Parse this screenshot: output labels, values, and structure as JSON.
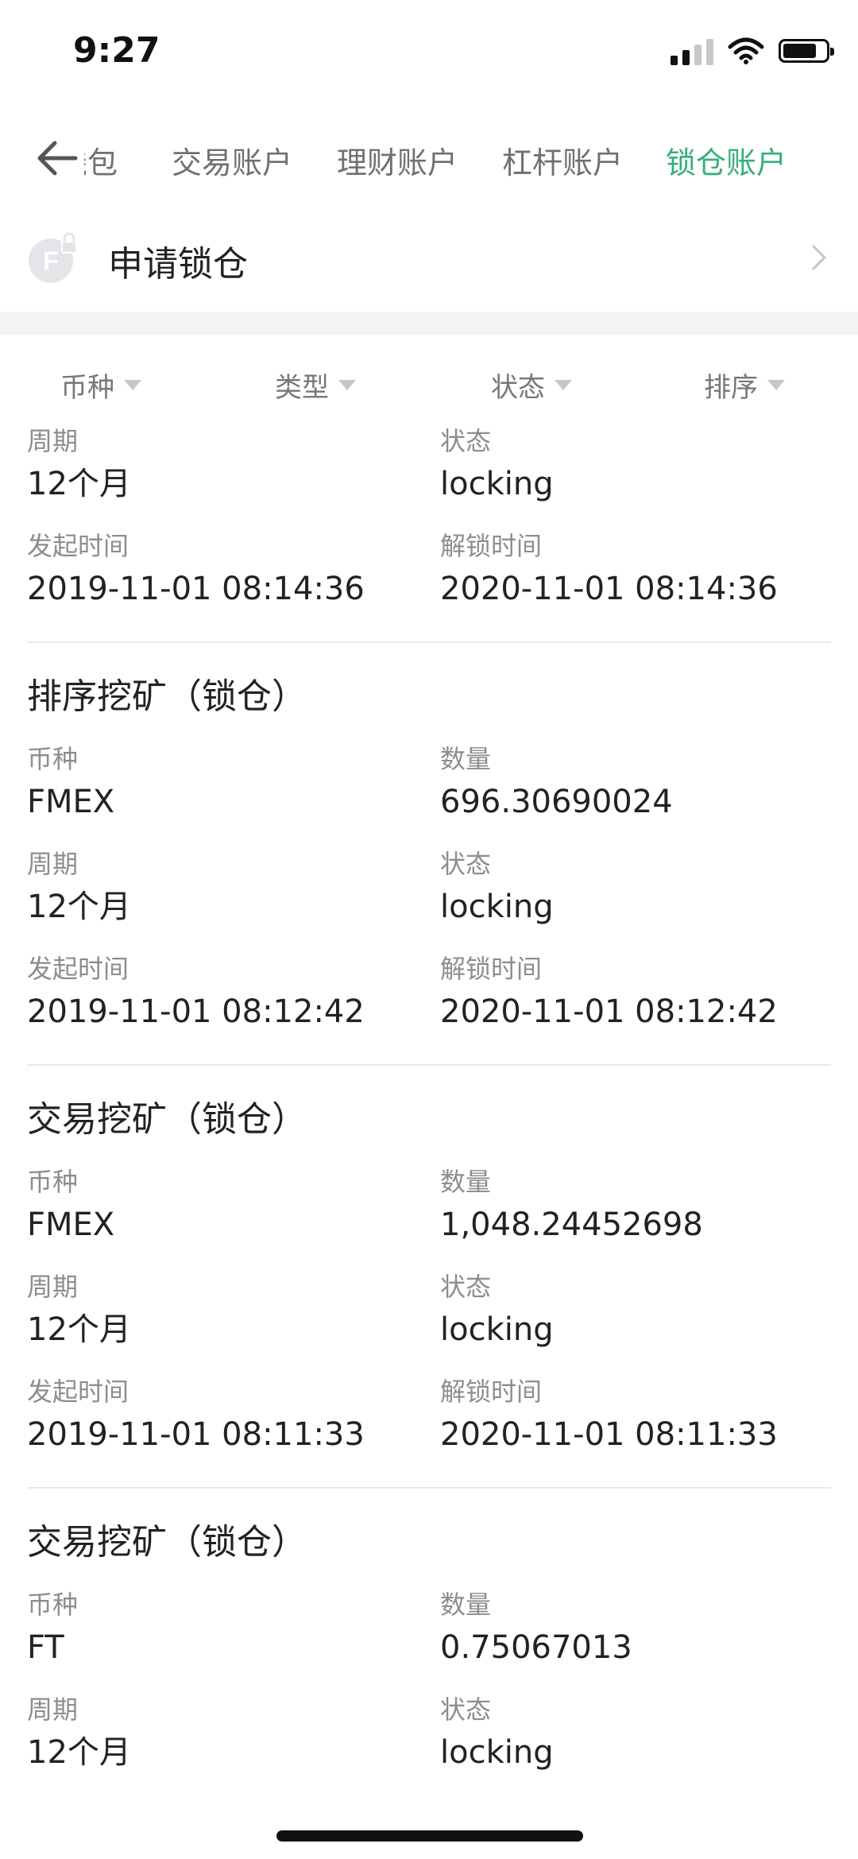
{
  "status_bar": {
    "time": "9:27"
  },
  "tabs": [
    {
      "label": "钱包",
      "active": false
    },
    {
      "label": "交易账户",
      "active": false
    },
    {
      "label": "理财账户",
      "active": false
    },
    {
      "label": "杠杆账户",
      "active": false
    },
    {
      "label": "锁仓账户",
      "active": true
    }
  ],
  "apply": {
    "label": "申请锁仓",
    "icon": "coin-lock-icon"
  },
  "filters": [
    "币种",
    "类型",
    "状态",
    "排序"
  ],
  "colors": {
    "accent": "#35b07a",
    "muted": "#8d8d8d",
    "divider": "#e8e8e8"
  },
  "records": [
    {
      "title": "",
      "fields": [
        {
          "label": "周期",
          "value": "12个月"
        },
        {
          "label": "状态",
          "value": "locking"
        },
        {
          "label": "发起时间",
          "value": "2019-11-01 08:14:36"
        },
        {
          "label": "解锁时间",
          "value": "2020-11-01 08:14:36"
        }
      ]
    },
    {
      "title": "排序挖矿（锁仓）",
      "fields": [
        {
          "label": "币种",
          "value": "FMEX"
        },
        {
          "label": "数量",
          "value": "696.30690024"
        },
        {
          "label": "周期",
          "value": "12个月"
        },
        {
          "label": "状态",
          "value": "locking"
        },
        {
          "label": "发起时间",
          "value": "2019-11-01 08:12:42"
        },
        {
          "label": "解锁时间",
          "value": "2020-11-01 08:12:42"
        }
      ]
    },
    {
      "title": "交易挖矿（锁仓）",
      "fields": [
        {
          "label": "币种",
          "value": "FMEX"
        },
        {
          "label": "数量",
          "value": "1,048.24452698"
        },
        {
          "label": "周期",
          "value": "12个月"
        },
        {
          "label": "状态",
          "value": "locking"
        },
        {
          "label": "发起时间",
          "value": "2019-11-01 08:11:33"
        },
        {
          "label": "解锁时间",
          "value": "2020-11-01 08:11:33"
        }
      ]
    },
    {
      "title": "交易挖矿（锁仓）",
      "fields": [
        {
          "label": "币种",
          "value": "FT"
        },
        {
          "label": "数量",
          "value": "0.75067013"
        },
        {
          "label": "周期",
          "value": "12个月"
        },
        {
          "label": "状态",
          "value": "locking"
        }
      ]
    }
  ]
}
